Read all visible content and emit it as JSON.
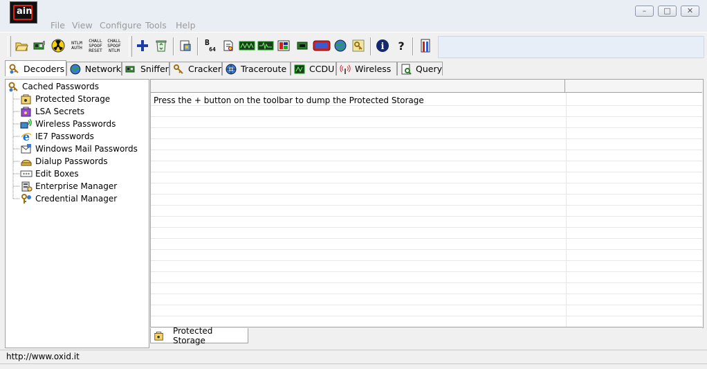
{
  "app": {
    "logo_text": "ain"
  },
  "menu": [
    "File",
    "View",
    "Configure",
    "Tools",
    "Help"
  ],
  "window_controls": {
    "minimize": "–",
    "maximize": "□",
    "close": "✕"
  },
  "toolbar": {
    "icons": [
      "open-folder-icon",
      "network-card-icon",
      "radiation-icon",
      "ntlm-auth-icon",
      "chall-spoof-reset-icon",
      "chall-spoof-ntlm-icon",
      "add-icon",
      "recycle-bin-icon",
      "config-icon",
      "base64-icon",
      "certificate-icon",
      "hash-calculator-icon",
      "voip-icon",
      "rdp-icon",
      "chip-icon",
      "router-icon",
      "network-globe-icon",
      "key-icon",
      "info-icon",
      "help-icon",
      "exit-icon"
    ],
    "ntlm_auth": [
      "NTLM",
      "AUTH"
    ],
    "chall_spoof_reset": [
      "CHALL",
      "SPOOF",
      "RESET"
    ],
    "chall_spoof_ntlm": [
      "CHALL",
      "SPOOF",
      "NTLM"
    ],
    "base64_b": "B",
    "base64_sub": "64"
  },
  "tabs": [
    {
      "label": "Decoders",
      "selected": true
    },
    {
      "label": "Network"
    },
    {
      "label": "Sniffer"
    },
    {
      "label": "Cracker"
    },
    {
      "label": "Traceroute"
    },
    {
      "label": "CCDU"
    },
    {
      "label": "Wireless"
    },
    {
      "label": "Query"
    }
  ],
  "tree": {
    "root": "Cached Passwords",
    "items": [
      "Protected Storage",
      "LSA Secrets",
      "Wireless Passwords",
      "IE7 Passwords",
      "Windows Mail Passwords",
      "Dialup Passwords",
      "Edit Boxes",
      "Enterprise Manager",
      "Credential Manager"
    ]
  },
  "grid": {
    "message": "Press the + button on the toolbar to dump the Protected Storage"
  },
  "bottom_tab": {
    "label": "Protected Storage"
  },
  "status": {
    "text": "http://www.oxid.it"
  }
}
